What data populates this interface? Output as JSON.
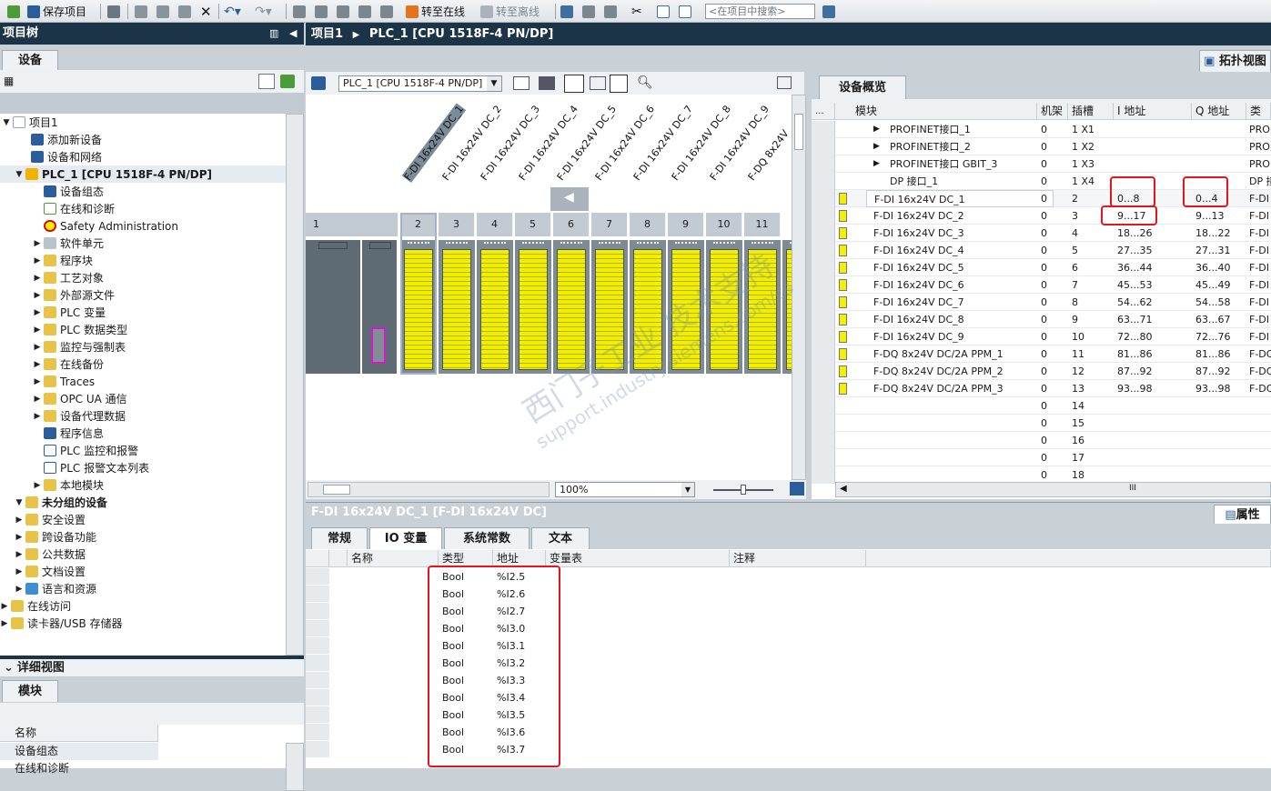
{
  "toolbar": {
    "save_label": "保存项目",
    "go_online_label": "转至在线",
    "go_offline_label": "转至离线",
    "search_placeholder": "<在项目中搜索>"
  },
  "project_tree": {
    "title": "项目树",
    "tab_devices": "设备",
    "items": [
      {
        "label": "项目1"
      },
      {
        "label": "添加新设备"
      },
      {
        "label": "设备和网络"
      },
      {
        "label": "PLC_1 [CPU 1518F-4 PN/DP]"
      },
      {
        "label": "设备组态"
      },
      {
        "label": "在线和诊断"
      },
      {
        "label": "Safety Administration"
      },
      {
        "label": "软件单元"
      },
      {
        "label": "程序块"
      },
      {
        "label": "工艺对象"
      },
      {
        "label": "外部源文件"
      },
      {
        "label": "PLC 变量"
      },
      {
        "label": "PLC 数据类型"
      },
      {
        "label": "监控与强制表"
      },
      {
        "label": "在线备份"
      },
      {
        "label": "Traces"
      },
      {
        "label": "OPC UA 通信"
      },
      {
        "label": "设备代理数据"
      },
      {
        "label": "程序信息"
      },
      {
        "label": "PLC 监控和报警"
      },
      {
        "label": "PLC 报警文本列表"
      },
      {
        "label": "本地模块"
      },
      {
        "label": "未分组的设备"
      },
      {
        "label": "安全设置"
      },
      {
        "label": "跨设备功能"
      },
      {
        "label": "公共数据"
      },
      {
        "label": "文档设置"
      },
      {
        "label": "语言和资源"
      },
      {
        "label": "在线访问"
      },
      {
        "label": "读卡器/USB 存储器"
      }
    ]
  },
  "detail_view": {
    "title": "详细视图",
    "tab_modules": "模块",
    "col_name": "名称",
    "rows": [
      "设备组态",
      "在线和诊断"
    ]
  },
  "breadcrumb": {
    "project": "项目1",
    "device": "PLC_1 [CPU 1518F-4 PN/DP]"
  },
  "topology_tab": "拓扑视图",
  "device_view": {
    "device_select": "PLC_1 [CPU 1518F-4 PN/DP]",
    "zoom": "100%",
    "module_names": [
      "F-DI 16x24V DC_1",
      "F-DI 16x24V DC_2",
      "F-DI 16x24V DC_3",
      "F-DI 16x24V DC_4",
      "F-DI 16x24V DC_5",
      "F-DI 16x24V DC_6",
      "F-DI 16x24V DC_7",
      "F-DI 16x24V DC_8",
      "F-DI 16x24V DC_9",
      "F-DQ 8x24V"
    ],
    "slots": [
      "1",
      "2",
      "3",
      "4",
      "5",
      "6",
      "7",
      "8",
      "9",
      "10",
      "11"
    ]
  },
  "device_overview": {
    "title": "设备概览",
    "headers": {
      "dots": "...",
      "module": "模块",
      "rack": "机架",
      "slot": "插槽",
      "i_addr": "I 地址",
      "q_addr": "Q 地址",
      "type": "类型"
    },
    "rows": [
      {
        "module": "PROFINET接口_1",
        "rack": "0",
        "slot": "1 X1",
        "i": "",
        "q": "",
        "type": "PROFI",
        "indent": 2,
        "yellow": false
      },
      {
        "module": "PROFINET接口_2",
        "rack": "0",
        "slot": "1 X2",
        "i": "",
        "q": "",
        "type": "PROFI",
        "indent": 2,
        "yellow": false
      },
      {
        "module": "PROFINET接口 GBIT_3",
        "rack": "0",
        "slot": "1 X3",
        "i": "",
        "q": "",
        "type": "PROFI",
        "indent": 2,
        "yellow": false
      },
      {
        "module": "DP 接口_1",
        "rack": "0",
        "slot": "1 X4",
        "i": "",
        "q": "",
        "type": "DP 接",
        "indent": 3,
        "yellow": false
      },
      {
        "module": "F-DI 16x24V DC_1",
        "rack": "0",
        "slot": "2",
        "i": "0...8",
        "q": "0...4",
        "type": "F-DI",
        "indent": 1,
        "yellow": true
      },
      {
        "module": "F-DI 16x24V DC_2",
        "rack": "0",
        "slot": "3",
        "i": "9...17",
        "q": "9...13",
        "type": "F-DI",
        "indent": 1,
        "yellow": true
      },
      {
        "module": "F-DI 16x24V DC_3",
        "rack": "0",
        "slot": "4",
        "i": "18...26",
        "q": "18...22",
        "type": "F-DI",
        "indent": 1,
        "yellow": true
      },
      {
        "module": "F-DI 16x24V DC_4",
        "rack": "0",
        "slot": "5",
        "i": "27...35",
        "q": "27...31",
        "type": "F-DI",
        "indent": 1,
        "yellow": true
      },
      {
        "module": "F-DI 16x24V DC_5",
        "rack": "0",
        "slot": "6",
        "i": "36...44",
        "q": "36...40",
        "type": "F-DI",
        "indent": 1,
        "yellow": true
      },
      {
        "module": "F-DI 16x24V DC_6",
        "rack": "0",
        "slot": "7",
        "i": "45...53",
        "q": "45...49",
        "type": "F-DI",
        "indent": 1,
        "yellow": true
      },
      {
        "module": "F-DI 16x24V DC_7",
        "rack": "0",
        "slot": "8",
        "i": "54...62",
        "q": "54...58",
        "type": "F-DI",
        "indent": 1,
        "yellow": true
      },
      {
        "module": "F-DI 16x24V DC_8",
        "rack": "0",
        "slot": "9",
        "i": "63...71",
        "q": "63...67",
        "type": "F-DI",
        "indent": 1,
        "yellow": true
      },
      {
        "module": "F-DI 16x24V DC_9",
        "rack": "0",
        "slot": "10",
        "i": "72...80",
        "q": "72...76",
        "type": "F-DI",
        "indent": 1,
        "yellow": true
      },
      {
        "module": "F-DQ 8x24V DC/2A PPM_1",
        "rack": "0",
        "slot": "11",
        "i": "81...86",
        "q": "81...86",
        "type": "F-DQ",
        "indent": 1,
        "yellow": true
      },
      {
        "module": "F-DQ 8x24V DC/2A PPM_2",
        "rack": "0",
        "slot": "12",
        "i": "87...92",
        "q": "87...92",
        "type": "F-DQ",
        "indent": 1,
        "yellow": true
      },
      {
        "module": "F-DQ 8x24V DC/2A PPM_3",
        "rack": "0",
        "slot": "13",
        "i": "93...98",
        "q": "93...98",
        "type": "F-DQ",
        "indent": 1,
        "yellow": true
      },
      {
        "module": "",
        "rack": "0",
        "slot": "14",
        "i": "",
        "q": "",
        "type": "",
        "indent": 0,
        "yellow": false
      },
      {
        "module": "",
        "rack": "0",
        "slot": "15",
        "i": "",
        "q": "",
        "type": "",
        "indent": 0,
        "yellow": false
      },
      {
        "module": "",
        "rack": "0",
        "slot": "16",
        "i": "",
        "q": "",
        "type": "",
        "indent": 0,
        "yellow": false
      },
      {
        "module": "",
        "rack": "0",
        "slot": "17",
        "i": "",
        "q": "",
        "type": "",
        "indent": 0,
        "yellow": false
      },
      {
        "module": "",
        "rack": "0",
        "slot": "18",
        "i": "",
        "q": "",
        "type": "",
        "indent": 0,
        "yellow": false
      }
    ]
  },
  "properties": {
    "title": "F-DI 16x24V DC_1 [F-DI 16x24V DC]",
    "props_tab": "属性",
    "tabs": [
      "常规",
      "IO 变量",
      "系统常数",
      "文本"
    ],
    "headers": {
      "name": "名称",
      "type": "类型",
      "address": "地址",
      "tag_table": "变量表",
      "comment": "注释"
    },
    "rows": [
      {
        "type": "Bool",
        "address": "%I2.5"
      },
      {
        "type": "Bool",
        "address": "%I2.6"
      },
      {
        "type": "Bool",
        "address": "%I2.7"
      },
      {
        "type": "Bool",
        "address": "%I3.0"
      },
      {
        "type": "Bool",
        "address": "%I3.1"
      },
      {
        "type": "Bool",
        "address": "%I3.2"
      },
      {
        "type": "Bool",
        "address": "%I3.3"
      },
      {
        "type": "Bool",
        "address": "%I3.4"
      },
      {
        "type": "Bool",
        "address": "%I3.5"
      },
      {
        "type": "Bool",
        "address": "%I3.6"
      },
      {
        "type": "Bool",
        "address": "%I3.7"
      }
    ]
  },
  "watermark": {
    "line1": "西门子工业 技术支持",
    "line2": "support.industry.siemens.com/cs"
  },
  "colors": {
    "title_bar": "#1b3447",
    "module_yellow": "#f2ef00",
    "highlight_red": "#e8141c",
    "panel_gray": "#c9d1d7"
  }
}
